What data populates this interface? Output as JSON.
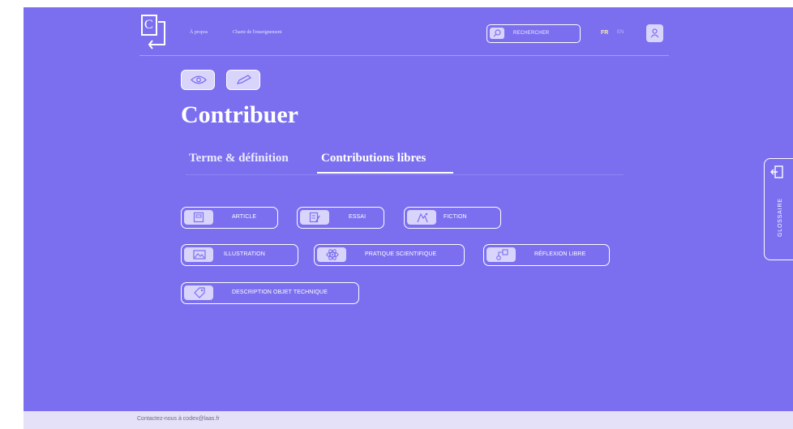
{
  "header": {
    "logo_letter": "C",
    "nav": [
      "À propos",
      "Charte de l'enseignement"
    ],
    "search_label": "RECHERCHER",
    "lang_active": "FR",
    "lang_other": "EN"
  },
  "page_title": "Contribuer",
  "tabs": [
    "Terme & définition",
    "Contributions libres"
  ],
  "active_tab": "Contributions libres",
  "contribution_types": [
    {
      "label": "ARTICLE",
      "icon": "article-icon"
    },
    {
      "label": "ESSAI",
      "icon": "essay-icon"
    },
    {
      "label": "FICTION",
      "icon": "fiction-icon"
    },
    {
      "label": "ILLUSTRATION",
      "icon": "image-icon"
    },
    {
      "label": "PRATIQUE SCIENTIFIQUE",
      "icon": "atom-icon"
    },
    {
      "label": "RÉFLEXION LIBRE",
      "icon": "reflection-icon"
    },
    {
      "label": "DESCRIPTION OBJET TECHNIQUE",
      "icon": "tag-icon"
    }
  ],
  "sidebar_tab": "GLOSSAIRE",
  "footer_text": "Contactez-nous à codex@laas.fr",
  "colors": {
    "background": "#7b6ff0",
    "icon_tile": "#d9d4fb",
    "footer": "#e4e1f8",
    "accent_lang": "#ffe9a8"
  }
}
